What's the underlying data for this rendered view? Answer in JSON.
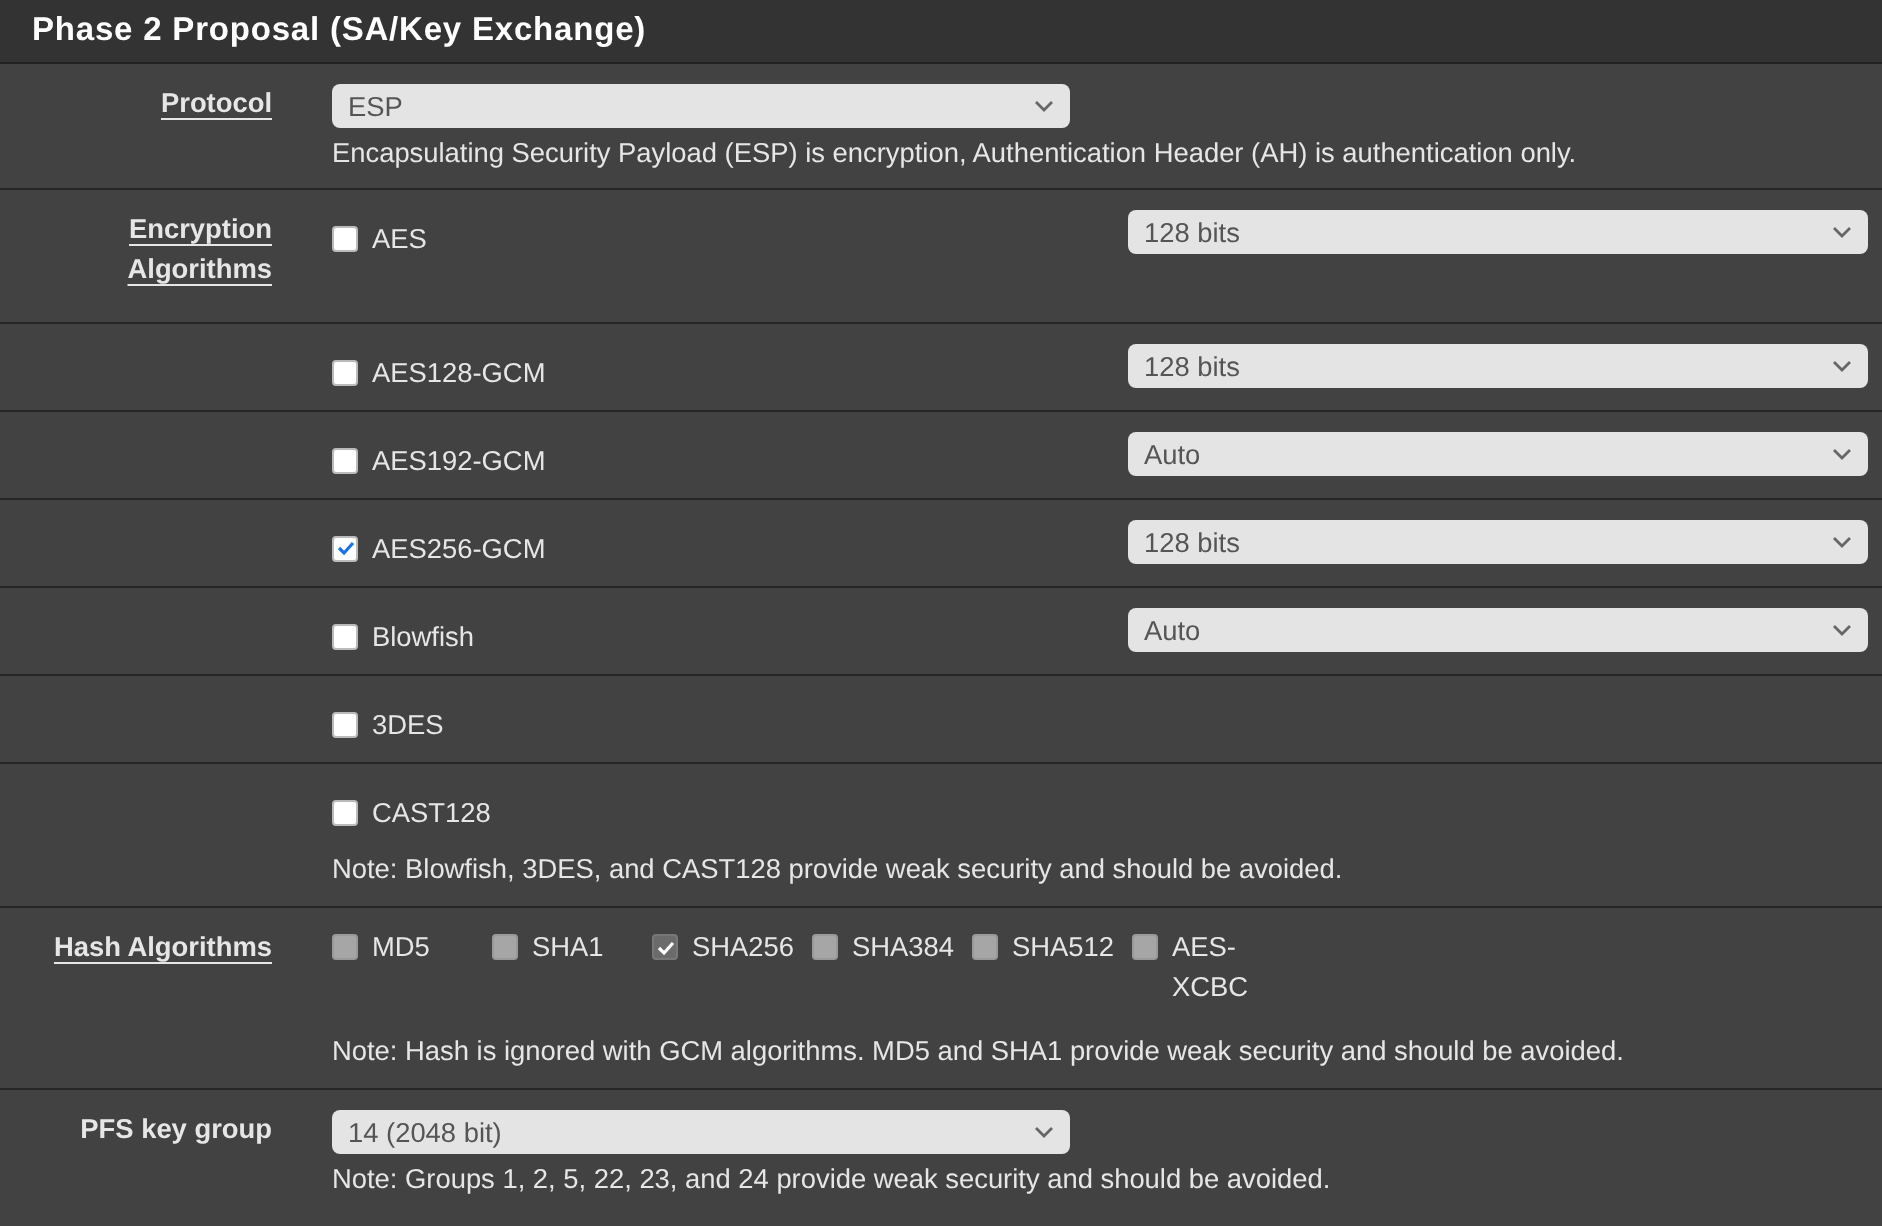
{
  "section": {
    "title": "Phase 2 Proposal (SA/Key Exchange)"
  },
  "protocol": {
    "label": "Protocol",
    "value": "ESP",
    "help": "Encapsulating Security Payload (ESP) is encryption, Authentication Header (AH) is authentication only."
  },
  "encryption": {
    "label": "Encryption Algorithms",
    "algorithms": [
      {
        "name": "AES",
        "checked": false,
        "key_length": "128 bits"
      },
      {
        "name": "AES128-GCM",
        "checked": false,
        "key_length": "128 bits"
      },
      {
        "name": "AES192-GCM",
        "checked": false,
        "key_length": "Auto"
      },
      {
        "name": "AES256-GCM",
        "checked": true,
        "key_length": "128 bits"
      },
      {
        "name": "Blowfish",
        "checked": false,
        "key_length": "Auto"
      },
      {
        "name": "3DES",
        "checked": false
      },
      {
        "name": "CAST128",
        "checked": false
      }
    ],
    "note": "Note: Blowfish, 3DES, and CAST128 provide weak security and should be avoided."
  },
  "hash": {
    "label": "Hash Algorithms",
    "options": [
      {
        "name": "MD5",
        "checked": false,
        "disabled": true
      },
      {
        "name": "SHA1",
        "checked": false,
        "disabled": true
      },
      {
        "name": "SHA256",
        "checked": true,
        "disabled": true
      },
      {
        "name": "SHA384",
        "checked": false,
        "disabled": true
      },
      {
        "name": "SHA512",
        "checked": false,
        "disabled": true
      },
      {
        "name": "AES-XCBC",
        "checked": false,
        "disabled": true
      }
    ],
    "note": "Note: Hash is ignored with GCM algorithms. MD5 and SHA1 provide weak security and should be avoided."
  },
  "pfs": {
    "label": "PFS key group",
    "value": "14 (2048 bit)",
    "note": "Note: Groups 1, 2, 5, 22, 23, and 24 provide weak security and should be avoided."
  }
}
